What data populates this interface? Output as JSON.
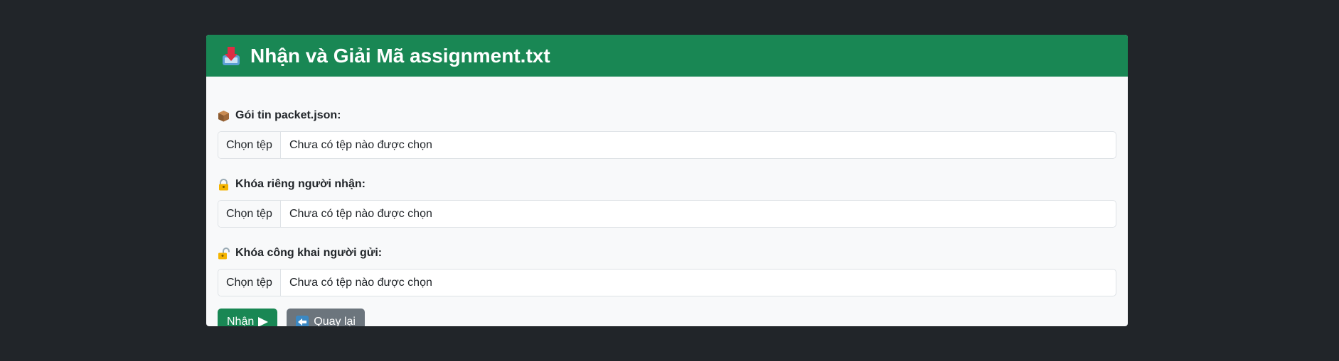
{
  "header": {
    "title": "Nhận và Giải Mã assignment.txt",
    "icon": "inbox-tray-icon"
  },
  "fields": [
    {
      "label": "Gói tin packet.json:",
      "icon": "package-icon",
      "button_label": "Chọn tệp",
      "status": "Chưa có tệp nào được chọn"
    },
    {
      "label": "Khóa riêng người nhận:",
      "icon": "locked-with-key-icon",
      "button_label": "Chọn tệp",
      "status": "Chưa có tệp nào được chọn"
    },
    {
      "label": "Khóa công khai người gửi:",
      "icon": "unlocked-icon",
      "button_label": "Chọn tệp",
      "status": "Chưa có tệp nào được chọn"
    }
  ],
  "actions": {
    "submit_label": "Nhận",
    "back_label": "Quay lại"
  },
  "colors": {
    "background": "#212529",
    "header": "#198754",
    "card": "#f8f9fa",
    "submit": "#198754",
    "back": "#6c757d"
  }
}
